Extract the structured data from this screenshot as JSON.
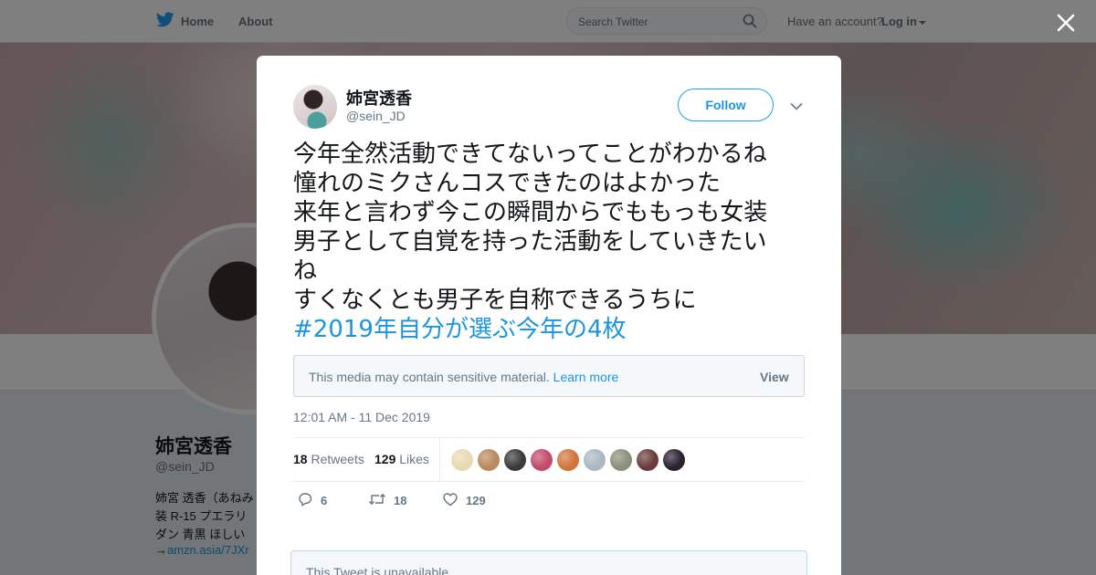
{
  "topbar": {
    "home_label": "Home",
    "about_label": "About",
    "search_placeholder": "Search Twitter",
    "account_prompt": "Have an account?",
    "login_label": "Log in"
  },
  "profile": {
    "name": "姉宮透香",
    "handle": "@sein_JD",
    "bio_lines": [
      "姉宮 透香（あねみ",
      "装 R-15 プエラリ",
      "ダン 青黒 ほしい",
      "→"
    ],
    "bio_link": "amzn.asia/7JXr"
  },
  "tweet": {
    "author_name": "姉宮透香",
    "author_handle": "@sein_JD",
    "follow_label": "Follow",
    "text_lines": [
      "今年全然活動できてないってことがわかるね",
      "憧れのミクさんコスできたのはよかった",
      "来年と言わず今この瞬間からでももっも女装",
      "男子として自覚を持った活動をしていきたい",
      "ね",
      "すくなくとも男子を自称できるうちに"
    ],
    "hashtag": "#2019年自分が選ぶ今年の4枚",
    "sensitive_message": "This media may contain sensitive material.",
    "learn_more": "Learn more",
    "view_label": "View",
    "timestamp": "12:01 AM - 11 Dec 2019",
    "retweets_count": "18",
    "retweets_label": "Retweets",
    "likes_count": "129",
    "likes_label": "Likes",
    "reply_count": "6",
    "retweet_action_count": "18",
    "like_action_count": "129",
    "unavailable_text": "This Tweet is unavailable."
  },
  "likers": [
    {
      "color": "#e8d9b0"
    },
    {
      "color": "#b88a5e"
    },
    {
      "color": "#3a3a3a"
    },
    {
      "color": "#c24a6a"
    },
    {
      "color": "#d0743a"
    },
    {
      "color": "#aab8c2"
    },
    {
      "color": "#8a8f7a"
    },
    {
      "color": "#6b3a3a"
    },
    {
      "color": "#2a2030"
    }
  ],
  "colors": {
    "twitter_blue": "#1da1f2",
    "link_blue": "#1b95e0",
    "secondary_text": "#657786"
  }
}
